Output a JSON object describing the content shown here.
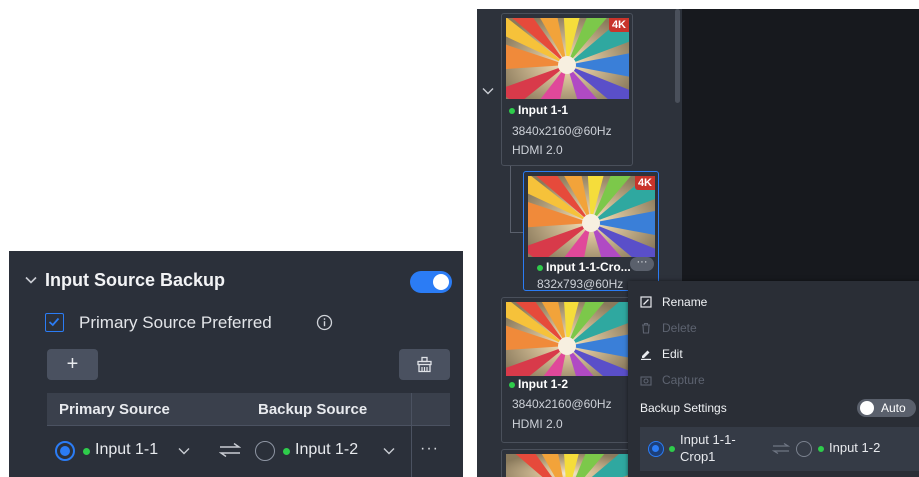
{
  "left_panel": {
    "title": "Input Source Backup",
    "toggle_on": true,
    "primary_preferred_label": "Primary Source Preferred",
    "primary_preferred_checked": true,
    "add_button_label": "+",
    "table": {
      "columns": [
        "Primary Source",
        "Backup Source"
      ],
      "rows": [
        {
          "primary": "Input 1-1",
          "primary_selected": true,
          "backup": "Input 1-2",
          "backup_selected": false,
          "more_label": "···"
        }
      ]
    }
  },
  "right_panel": {
    "cards": [
      {
        "name": "Input 1-1",
        "resolution": "3840x2160@60Hz",
        "interface": "HDMI 2.0",
        "badge": "4K"
      },
      {
        "name": "Input 1-1-Cro...",
        "resolution": "832x793@60Hz",
        "badge": "4K",
        "more_label": "···"
      },
      {
        "name": "Input 1-2",
        "resolution": "3840x2160@60Hz",
        "interface": "HDMI 2.0"
      }
    ],
    "context_menu": {
      "items": [
        {
          "label": "Rename",
          "icon": "rename-icon",
          "enabled": true
        },
        {
          "label": "Delete",
          "icon": "trash-icon",
          "enabled": false
        },
        {
          "label": "Edit",
          "icon": "edit-icon",
          "enabled": true
        },
        {
          "label": "Capture",
          "icon": "camera-icon",
          "enabled": false
        }
      ],
      "backup_settings_label": "Backup Settings",
      "auto_label": "Auto",
      "auto_on": false,
      "backup_row": {
        "primary_line1": "Input 1-1-",
        "primary_line2": "Crop1",
        "backup": "Input 1-2"
      }
    }
  },
  "colors": {
    "accent": "#2b7cf5",
    "status_online": "#2ecc4b",
    "badge_4k": "#c9342b"
  }
}
